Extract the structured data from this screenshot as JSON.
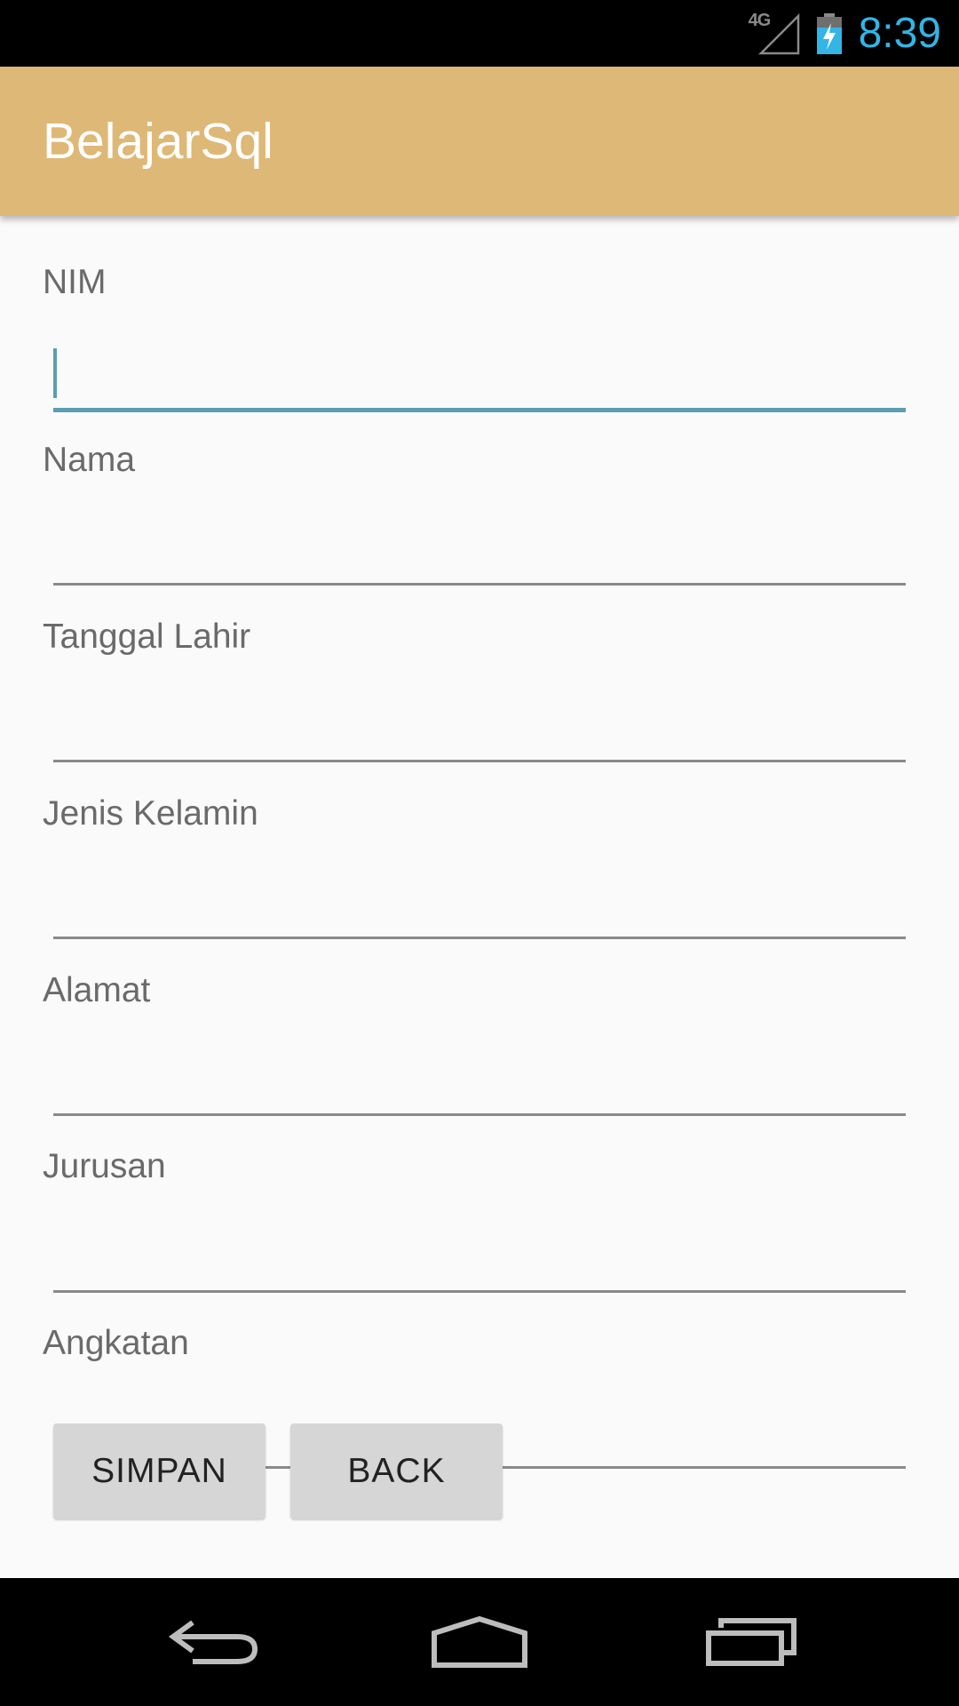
{
  "status_bar": {
    "network_type": "4G",
    "clock": "8:39",
    "icons": [
      "signal-icon",
      "battery-charging-icon"
    ],
    "clock_color": "#33b5e5"
  },
  "app_bar": {
    "title": "BelajarSql",
    "background_color": "#deb876"
  },
  "form": {
    "fields": [
      {
        "label": "NIM",
        "value": "",
        "focused": true
      },
      {
        "label": "Nama",
        "value": ""
      },
      {
        "label": "Tanggal Lahir",
        "value": ""
      },
      {
        "label": "Jenis Kelamin",
        "value": ""
      },
      {
        "label": "Alamat",
        "value": ""
      },
      {
        "label": "Jurusan",
        "value": ""
      },
      {
        "label": "Angkatan",
        "value": ""
      }
    ],
    "focus_color": "#5a9fb1"
  },
  "buttons": {
    "save": "SIMPAN",
    "back": "BACK"
  },
  "nav_bar": {
    "icons": [
      "back-icon",
      "home-icon",
      "recent-apps-icon"
    ]
  }
}
